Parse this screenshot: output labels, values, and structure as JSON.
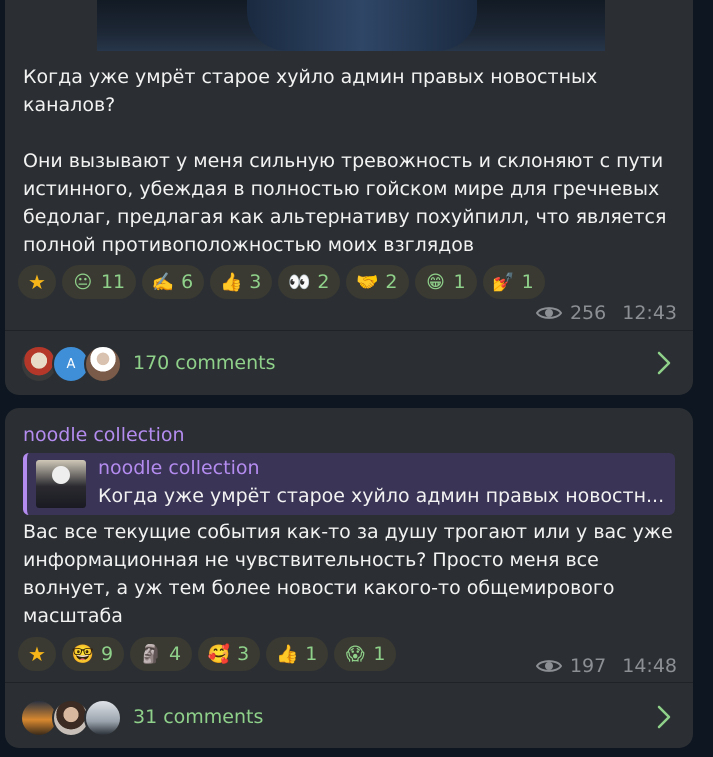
{
  "post1": {
    "text": "Когда уже умрёт старое хуйло админ правых новостных каналов?\n\nОни вызывают у меня сильную тревожность и склоняют с пути истинного, убеждая в полностью гойском мире для гречневых бедолаг, предлагая как альтернативу похуйпилл, что является полной противоположностью моих взглядов",
    "reactions": [
      {
        "emoji": "star",
        "count": ""
      },
      {
        "emoji": "😐",
        "count": "11"
      },
      {
        "emoji": "✍️",
        "count": "6"
      },
      {
        "emoji": "👍",
        "count": "3"
      },
      {
        "emoji": "👀",
        "count": "2"
      },
      {
        "emoji": "🤝",
        "count": "2"
      },
      {
        "emoji": "😁",
        "count": "1"
      },
      {
        "emoji": "💅",
        "count": "1"
      }
    ],
    "views": "256",
    "time": "12:43",
    "avatar_letter": "A",
    "comments": "170 comments"
  },
  "post2": {
    "channel": "noodle collection",
    "reply": {
      "title": "noodle collection",
      "text": "Когда уже умрёт старое хуйло админ правых новостн..."
    },
    "text": "Вас все текущие события как-то за душу трогают или у вас уже информационная не чувствительность? Просто меня все волнует, а уж тем более новости какого-то общемирового масштаба",
    "reactions": [
      {
        "emoji": "star",
        "count": ""
      },
      {
        "emoji": "🤓",
        "count": "9"
      },
      {
        "emoji": "🗿",
        "count": "4"
      },
      {
        "emoji": "🥰",
        "count": "3"
      },
      {
        "emoji": "👍",
        "count": "1"
      },
      {
        "emoji": "😱",
        "count": "1"
      }
    ],
    "views": "197",
    "time": "14:48",
    "comments": "31 comments"
  },
  "colors": {
    "background": "#0e1621",
    "bubble": "#2b2f33",
    "accent_green": "#8fd18a",
    "accent_purple": "#b48cf0",
    "star": "#f6b519",
    "meta_gray": "#8c8f93"
  },
  "icons": {
    "views": "eye-icon",
    "comments_arrow": "chevron-right-icon",
    "paid_reaction": "star-icon"
  }
}
